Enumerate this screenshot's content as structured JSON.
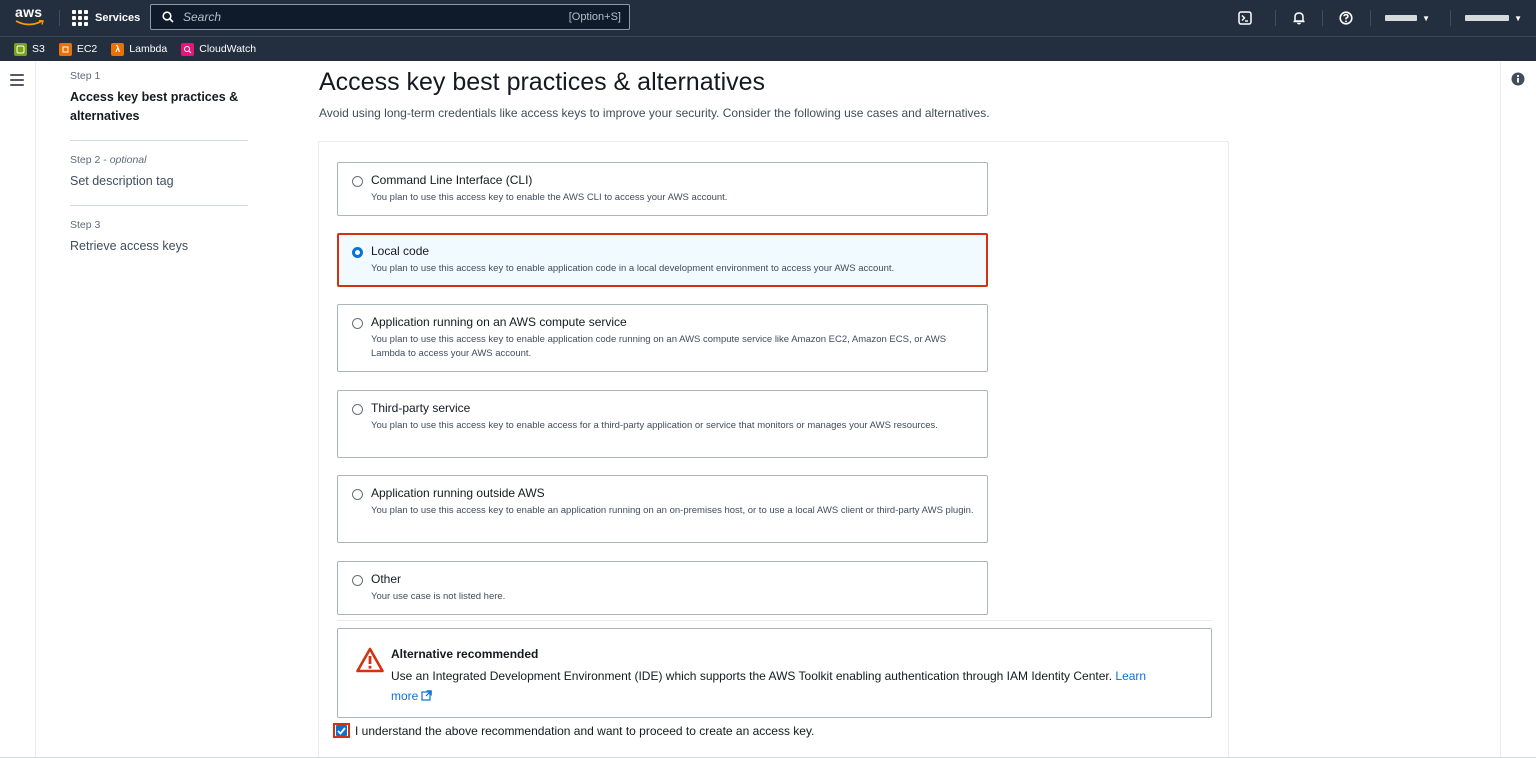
{
  "nav": {
    "logo": "aws",
    "services_label": "Services",
    "search_placeholder": "Search",
    "search_shortcut": "[Option+S]",
    "icons": [
      "cloudshell-icon",
      "bell-icon",
      "help-icon"
    ]
  },
  "favorites": [
    {
      "label": "S3",
      "color": "#7aa116"
    },
    {
      "label": "EC2",
      "color": "#ed7100"
    },
    {
      "label": "Lambda",
      "color": "#ed7100"
    },
    {
      "label": "CloudWatch",
      "color": "#e7157b"
    }
  ],
  "steps": [
    {
      "num": "Step 1",
      "title": "Access key best practices & alternatives",
      "active": true
    },
    {
      "num": "Step 2",
      "optional": "optional",
      "title": "Set description tag",
      "active": false
    },
    {
      "num": "Step 3",
      "title": "Retrieve access keys",
      "active": false
    }
  ],
  "page": {
    "title": "Access key best practices & alternatives",
    "description": "Avoid using long-term credentials like access keys to improve your security. Consider the following use cases and alternatives."
  },
  "options": [
    {
      "title": "Command Line Interface (CLI)",
      "desc": "You plan to use this access key to enable the AWS CLI to access your AWS account.",
      "selected": false
    },
    {
      "title": "Local code",
      "desc": "You plan to use this access key to enable application code in a local development environment to access your AWS account.",
      "selected": true
    },
    {
      "title": "Application running on an AWS compute service",
      "desc": "You plan to use this access key to enable application code running on an AWS compute service like Amazon EC2, Amazon ECS, or AWS Lambda to access your AWS account.",
      "selected": false
    },
    {
      "title": "Third-party service",
      "desc": "You plan to use this access key to enable access for a third-party application or service that monitors or manages your AWS resources.",
      "selected": false
    },
    {
      "title": "Application running outside AWS",
      "desc": "You plan to use this access key to enable an application running on an on-premises host, or to use a local AWS client or third-party AWS plugin.",
      "selected": false
    },
    {
      "title": "Other",
      "desc": "Your use case is not listed here.",
      "selected": false
    }
  ],
  "alert": {
    "title": "Alternative recommended",
    "body": "Use an Integrated Development Environment (IDE) which supports the AWS Toolkit enabling authentication through IAM Identity Center.",
    "link": "Learn more"
  },
  "acknowledge": {
    "label": "I understand the above recommendation and want to proceed to create an access key.",
    "checked": true
  },
  "colors": {
    "nav_bg": "#232f3e",
    "highlight": "#d13212",
    "primary": "#0972d3"
  }
}
